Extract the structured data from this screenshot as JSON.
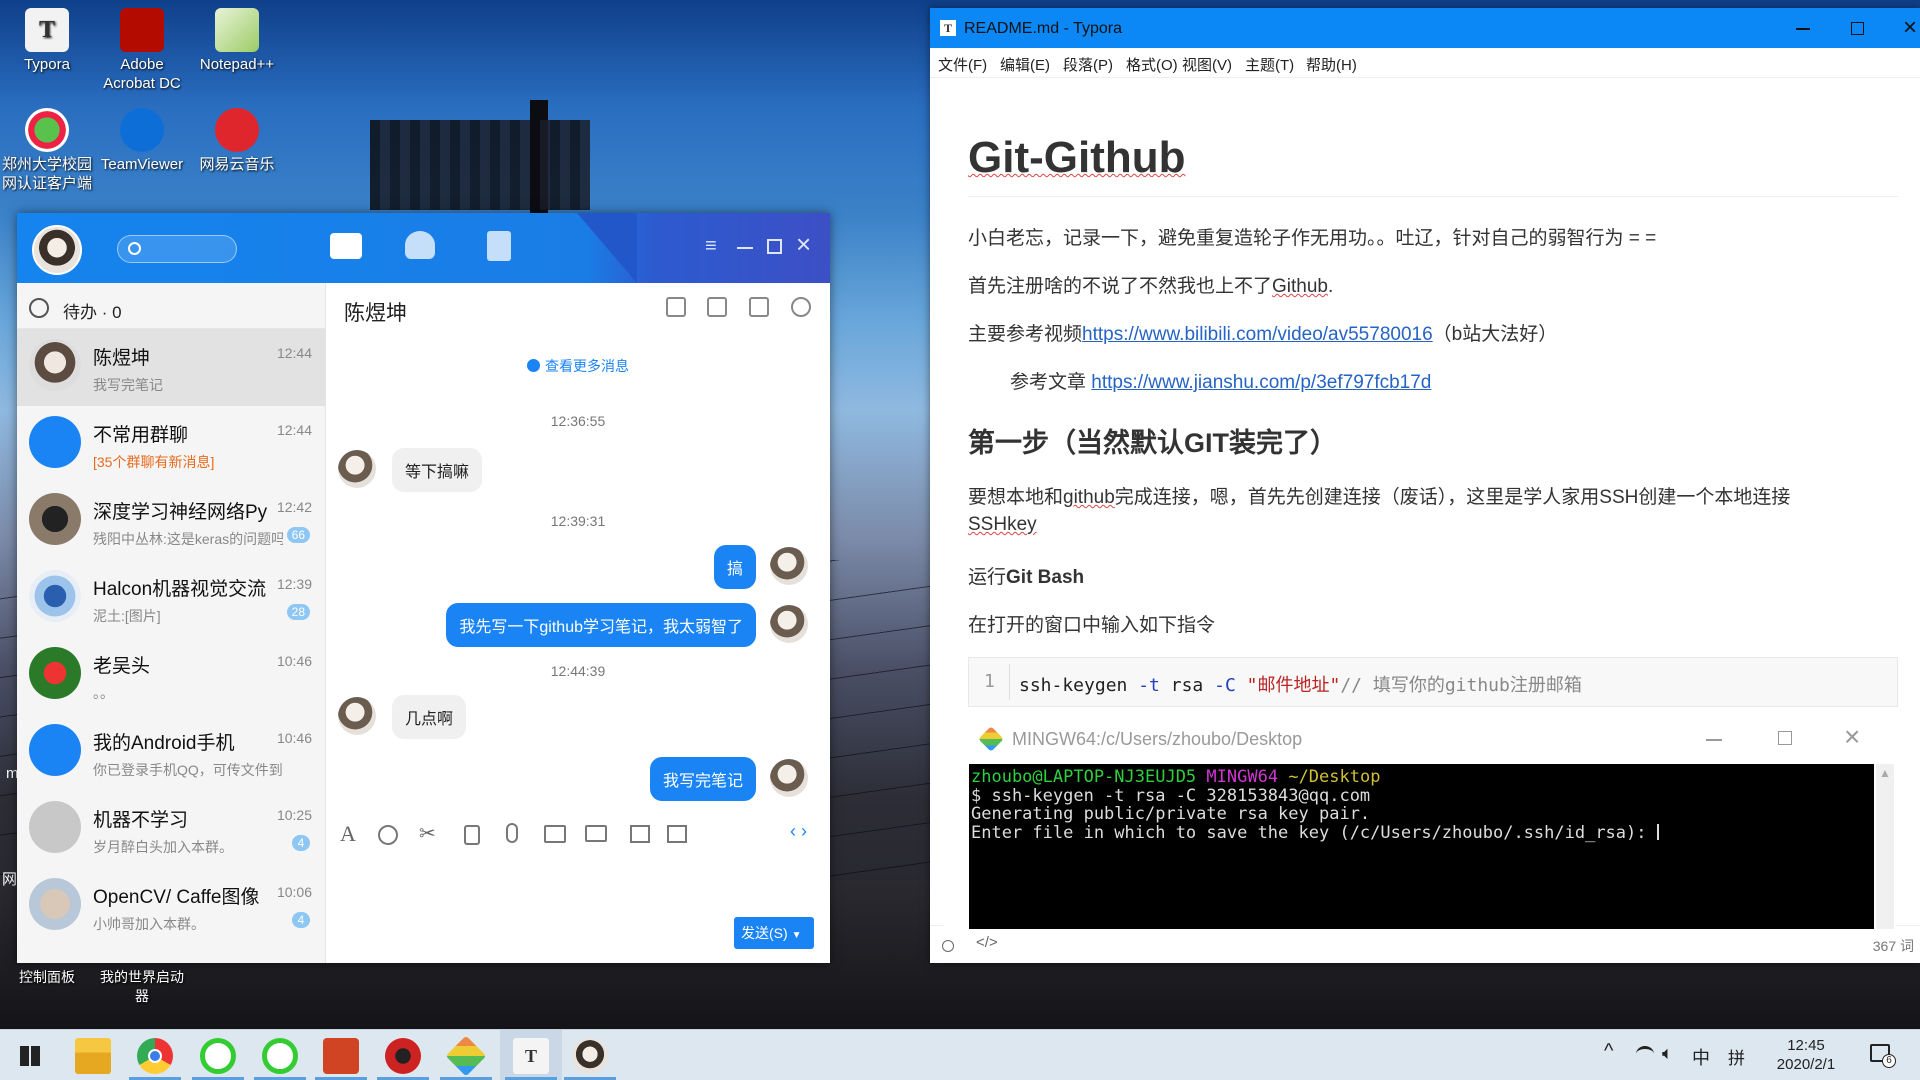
{
  "desktop": {
    "icons": [
      {
        "label": "Typora"
      },
      {
        "label": "Adobe Acrobat DC"
      },
      {
        "label": "Notepad++"
      },
      {
        "label": "郑州大学校园网认证客户端"
      },
      {
        "label": "TeamViewer"
      },
      {
        "label": "网易云音乐"
      },
      {
        "label": "控制面板"
      },
      {
        "label": "我的世界启动器"
      }
    ],
    "edge_glyphs": [
      "m",
      "网"
    ]
  },
  "qq": {
    "search_placeholder": "",
    "todo": "待办 · 0",
    "chat_title": "陈煜坤",
    "more_msgs": "查看更多消息",
    "conversations": [
      {
        "name": "陈煜坤",
        "time": "12:44",
        "preview": "我写完笔记",
        "badge": ""
      },
      {
        "name": "不常用群聊",
        "time": "12:44",
        "preview": "[35个群聊有新消息]",
        "badge": ""
      },
      {
        "name": "深度学习神经网络Py",
        "time": "12:42",
        "preview": "残阳中丛林:这是keras的问题吗",
        "badge": "66"
      },
      {
        "name": "Halcon机器视觉交流",
        "time": "12:39",
        "preview": "泥土:[图片]",
        "badge": "28"
      },
      {
        "name": "老吴头",
        "time": "10:46",
        "preview": "。。",
        "badge": ""
      },
      {
        "name": "我的Android手机",
        "time": "10:46",
        "preview": "你已登录手机QQ，可传文件到手机",
        "badge": ""
      },
      {
        "name": "机器不学习",
        "time": "10:25",
        "preview": "岁月醉白头加入本群。",
        "badge": "4"
      },
      {
        "name": "OpenCV/ Caffe图像",
        "time": "10:06",
        "preview": "小帅哥加入本群。",
        "badge": "4"
      }
    ],
    "messages": [
      {
        "time": "12:36:55"
      },
      {
        "text": "等下搞嘛",
        "dir": "in"
      },
      {
        "time": "12:39:31"
      },
      {
        "text": "搞",
        "dir": "out"
      },
      {
        "text": "我先写一下github学习笔记，我太弱智了",
        "dir": "out"
      },
      {
        "time": "12:44:39"
      },
      {
        "text": "几点啊",
        "dir": "in"
      },
      {
        "text": "我写完笔记",
        "dir": "out"
      }
    ],
    "send_label": "发送(S)",
    "colors": {
      "accent": "#1584ee",
      "bubble_out": "#1b84f5"
    }
  },
  "typora": {
    "title": "README.md - Typora",
    "menu": [
      "文件(F)",
      "编辑(E)",
      "段落(P)",
      "格式(O)",
      "视图(V)",
      "主题(T)",
      "帮助(H)"
    ],
    "h1": "Git-Github",
    "p1": "小白老忘，记录一下，避免重复造轮子作无用功。。吐辽，针对自己的弱智行为 = =",
    "p2a": "首先注册啥的不说了不然我也上不了",
    "p2b": "Github",
    "p2c": ".",
    "p3a": "主要参考视频",
    "p3link": "https://www.bilibili.com/video/av55780016",
    "p3b": "（b站大法好）",
    "p4a": "参考文章 ",
    "p4link": "https://www.jianshu.com/p/3ef797fcb17d",
    "h2": "第一步（当然默认GIT装完了）",
    "p5a": "要想本地和",
    "p5b": "github",
    "p5c": "完成连接，嗯，首先先创建连接（废话），这里是学人家用SSH创建一个本地连接",
    "p5d": "SSHkey",
    "p6a": "运行",
    "p6b": "Git Bash",
    "p7": "在打开的窗口中输入如下指令",
    "code_line_no": "1",
    "code": {
      "cmd": "ssh-keygen",
      "f1": "-t",
      "v1": "rsa",
      "f2": "-C",
      "str": "\"邮件地址\"",
      "comment": "// 填写你的github注册邮箱"
    },
    "word_count": "367 词"
  },
  "mingw": {
    "title": "MINGW64:/c/Users/zhoubo/Desktop",
    "prompt_user": "zhoubo@LAPTOP-NJ3EUJD5",
    "prompt_env": "MINGW64",
    "prompt_path": "~/Desktop",
    "lines": [
      "$ ssh-keygen -t rsa -C 328153843@qq.com",
      "Generating public/private rsa key pair.",
      "Enter file in which to save the key (/c/Users/zhoubo/.ssh/id_rsa): "
    ]
  },
  "taskbar": {
    "time": "12:45",
    "date": "2020/2/1",
    "ime": "中",
    "ime2": "拼",
    "notify_count": "6"
  }
}
